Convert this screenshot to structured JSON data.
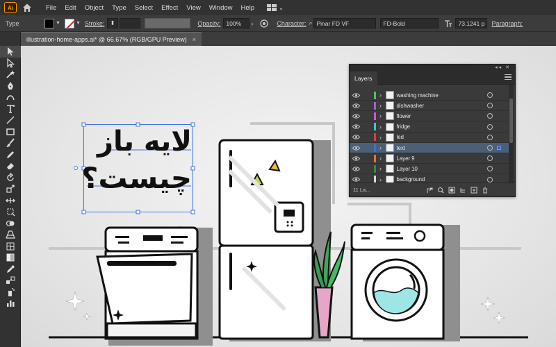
{
  "app": {
    "logo": "Ai"
  },
  "menu": [
    "File",
    "Edit",
    "Object",
    "Type",
    "Select",
    "Effect",
    "View",
    "Window",
    "Help"
  ],
  "control": {
    "tool_label": "Type",
    "stroke_label": "Stroke:",
    "opacity_label": "Opacity:",
    "opacity_value": "100%",
    "character_label": "Character:",
    "font_family": "Pinar FD VF",
    "font_style": "FD-Bold",
    "font_size": "73.1241 p",
    "paragraph_label": "Paragraph:"
  },
  "document": {
    "tab_title": "illustration-home-apps.ai* @ 66.67% (RGB/GPU Preview)",
    "close": "×"
  },
  "artboard": {
    "headline_line1": "لایه باز",
    "headline_line2": "چیست؟"
  },
  "layers_panel": {
    "tab": "Layers",
    "count": "11 La...",
    "layers": [
      {
        "name": "washing machine",
        "color": "#4ec26a"
      },
      {
        "name": "dishwasher",
        "color": "#a05fd6"
      },
      {
        "name": "flower",
        "color": "#d94fcf"
      },
      {
        "name": "fridge",
        "color": "#3fc9c9"
      },
      {
        "name": "led",
        "color": "#e23c3c"
      },
      {
        "name": "text",
        "color": "#3c6fe2",
        "selected": true
      },
      {
        "name": "Layer 9",
        "color": "#e6742a"
      },
      {
        "name": "Layer 10",
        "color": "#2e8f3b"
      },
      {
        "name": "background",
        "color": "#d8d8d8"
      }
    ]
  },
  "icons": {
    "toolbar": [
      "selection-icon",
      "direct-selection-icon",
      "magic-wand-icon",
      "pen-icon",
      "curvature-icon",
      "type-icon",
      "line-icon",
      "rectangle-icon",
      "paintbrush-icon",
      "pencil-icon",
      "eraser-icon",
      "rotate-icon",
      "scale-icon",
      "width-icon",
      "free-transform-icon",
      "shape-builder-icon",
      "perspective-icon",
      "mesh-icon",
      "gradient-icon",
      "eyedropper-icon",
      "blend-icon",
      "symbol-sprayer-icon",
      "graph-icon"
    ],
    "panel_footer": [
      "export-icon",
      "locate-icon",
      "clip-mask-icon",
      "new-sublayer-icon",
      "new-layer-icon",
      "delete-icon"
    ]
  }
}
